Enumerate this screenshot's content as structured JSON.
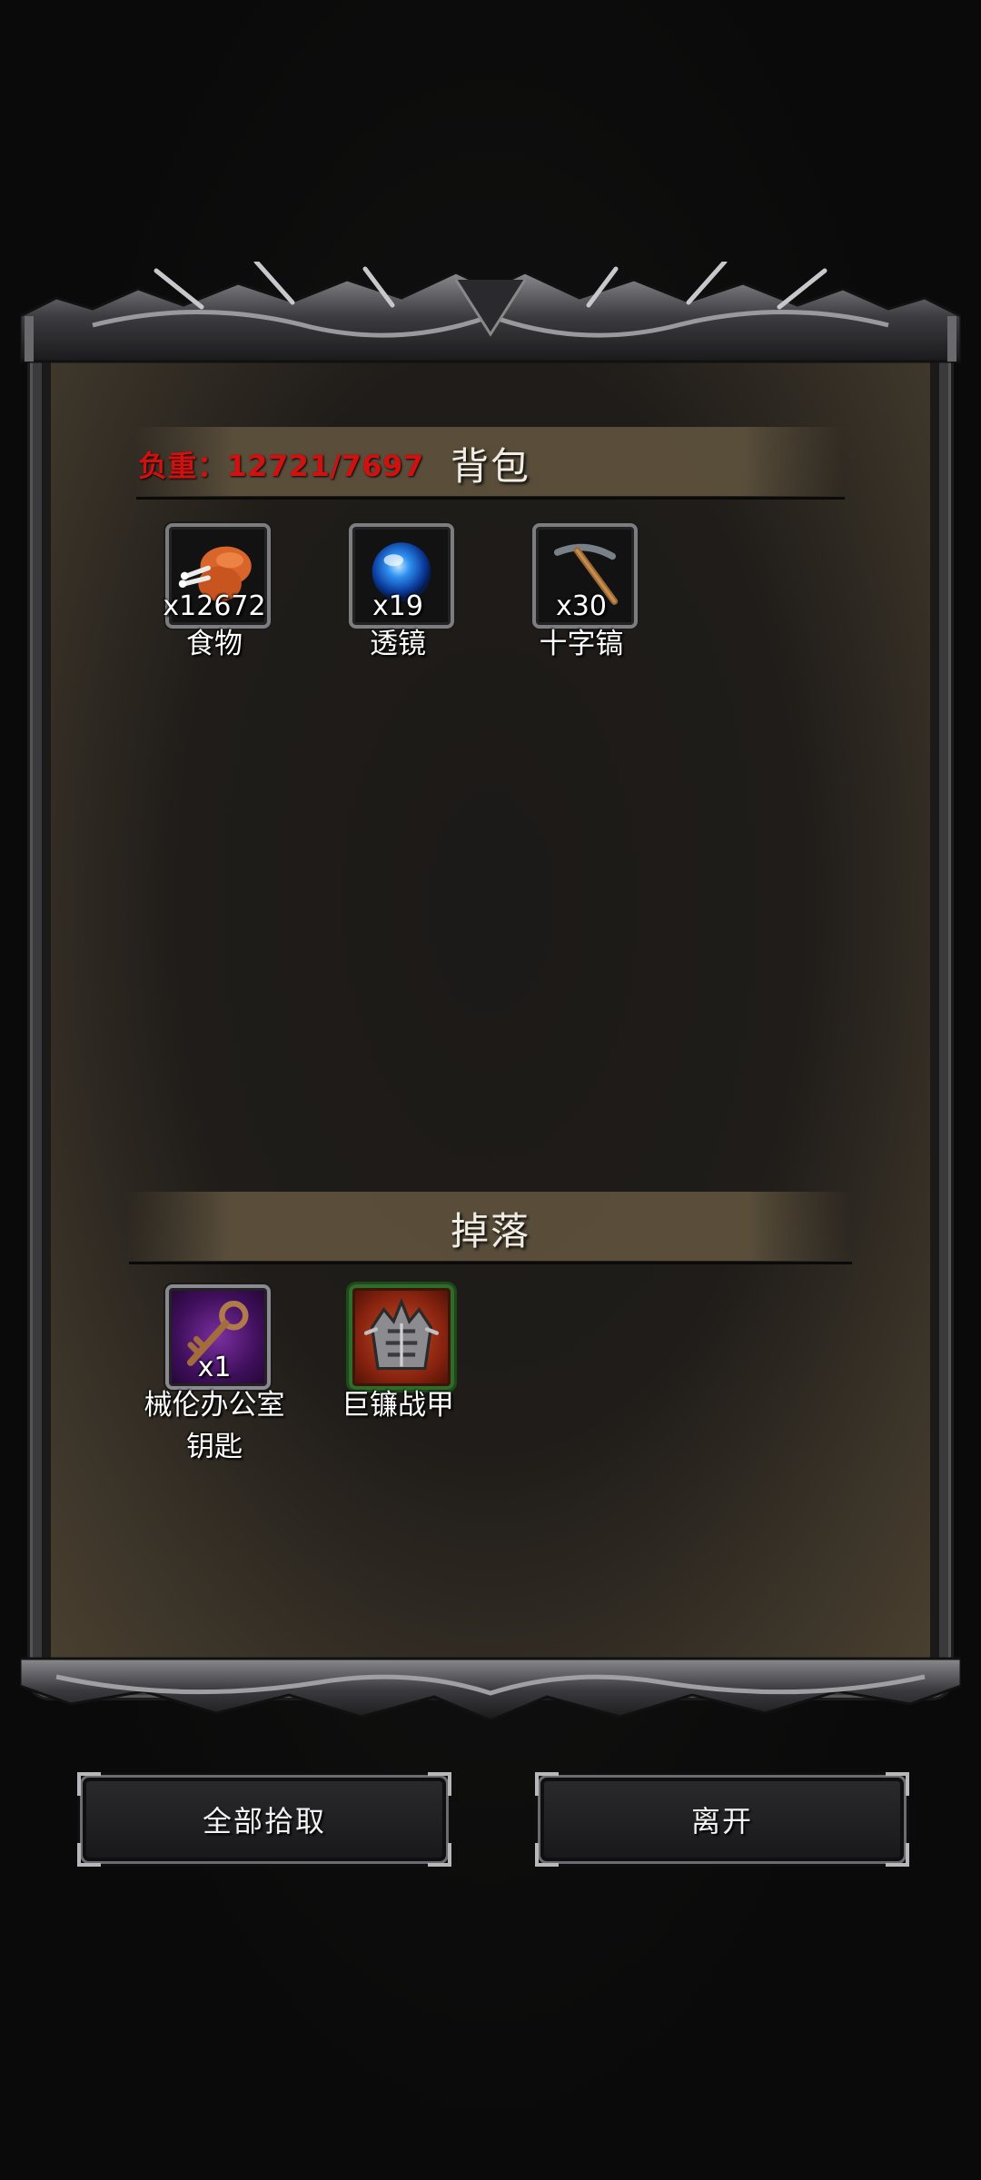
{
  "backpack": {
    "weight_label": "负重：12721/7697",
    "title": "背包",
    "items": [
      {
        "name": "食物",
        "count": "x12672",
        "icon": "meat-icon"
      },
      {
        "name": "透镜",
        "count": "x19",
        "icon": "blue-orb-icon"
      },
      {
        "name": "十字镐",
        "count": "x30",
        "icon": "pickaxe-icon"
      }
    ]
  },
  "drops": {
    "title": "掉落",
    "items": [
      {
        "name": "械伦办公室\n钥匙",
        "name_line1": "械伦办公室",
        "name_line2": "钥匙",
        "count": "x1",
        "icon": "key-icon",
        "rarity_color": "#6a1e8c"
      },
      {
        "name": "巨镰战甲",
        "count": "",
        "icon": "spiked-armor-icon",
        "rarity_color": "#a8361a"
      }
    ]
  },
  "buttons": {
    "pick_all": "全部拾取",
    "leave": "离开"
  },
  "colors": {
    "weight_text": "#d11010",
    "section_bar": "#5c503c",
    "background": "#0b0b0b"
  }
}
